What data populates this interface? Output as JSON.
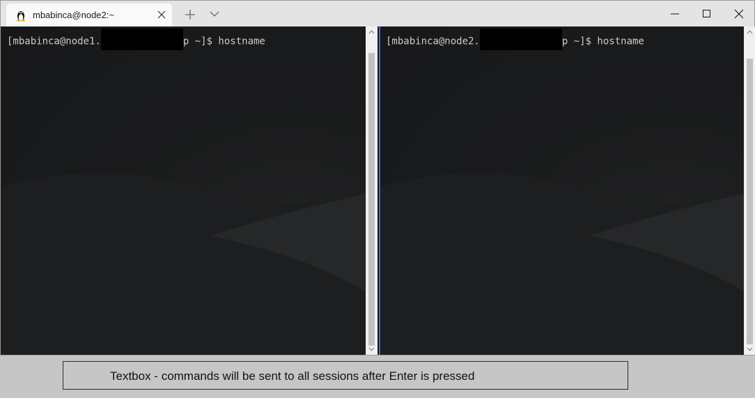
{
  "tab": {
    "title": "mbabinca@node2:~",
    "icon": "linux-penguin-icon"
  },
  "toolbar": {
    "new_tab_icon": "plus-icon",
    "dropdown_icon": "chevron-down-icon"
  },
  "window_controls": [
    "minimize-icon",
    "maximize-icon",
    "close-icon"
  ],
  "panes": [
    {
      "prompt_start": "[mbabinca@node1.",
      "prompt_end": "p ~]$ hostname"
    },
    {
      "prompt_start": "[mbabinca@node2.",
      "prompt_end": "p ~]$ hostname"
    }
  ],
  "broadcast": {
    "placeholder": "Textbox - commands will be sent to all sessions after Enter is pressed"
  },
  "colors": {
    "focus_border": "#2f6fd6",
    "terminal_bg": "#191a1b",
    "titlebar_bg": "#e4e4e4"
  }
}
